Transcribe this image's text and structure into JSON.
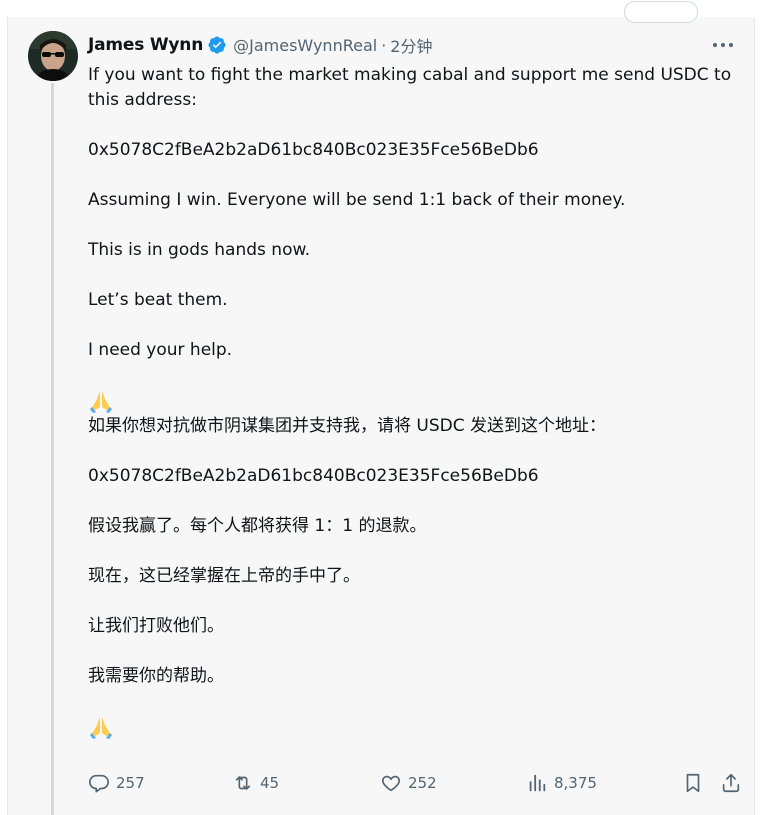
{
  "tweet": {
    "author": {
      "display_name": "James Wynn",
      "handle": "@JamesWynnReal",
      "time_separator": "·",
      "time": "2分钟"
    },
    "text_en": {
      "line1": "If you want to fight the market making cabal and support me send USDC to this address:",
      "address": "0x5078C2fBeA2b2aD61bc840Bc023E35Fce56BeDb6",
      "line2": "Assuming I win. Everyone will be send 1:1 back of their money.",
      "line3": "This is in gods hands now.",
      "line4": "Let’s beat them.",
      "line5": "I need your help."
    },
    "text_zh": {
      "line1": "如果你想对抗做市阴谋集团并支持我，请将 USDC 发送到这个地址：",
      "address": "0x5078C2fBeA2b2aD61bc840Bc023E35Fce56BeDb6",
      "line2": "假设我赢了。每个人都将获得 1：1 的退款。",
      "line3": "现在，这已经掌握在上帝的手中了。",
      "line4": "让我们打败他们。",
      "line5": "我需要你的帮助。"
    },
    "emoji": "folded-hands",
    "stats": {
      "replies": "257",
      "reposts": "45",
      "likes": "252",
      "views": "8,375"
    }
  },
  "colors": {
    "text": "#0f1419",
    "secondary": "#536471",
    "verified": "#1d9bf0",
    "card_bg": "#f7f7f8",
    "thread_line": "#cfd9de"
  },
  "icons": {
    "verified": "verified-badge-icon",
    "more": "more-horizontal-icon",
    "reply": "reply-icon",
    "repost": "repost-icon",
    "like": "heart-icon",
    "views": "bar-chart-icon",
    "bookmark": "bookmark-icon",
    "share": "share-icon"
  }
}
